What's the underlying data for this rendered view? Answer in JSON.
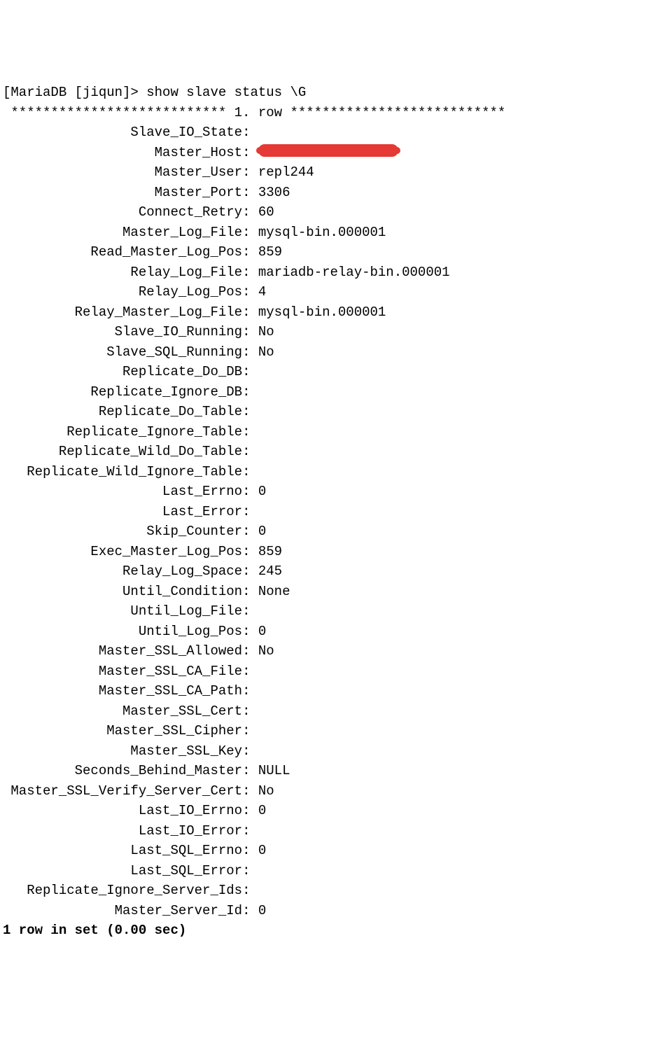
{
  "prompt": "[MariaDB [jiqun]> show slave status \\G",
  "separator_left": " *************************** ",
  "separator_mid": "1. row",
  "separator_right": " ***************************",
  "footer": "1 row in set (0.00 sec)",
  "colon": ": ",
  "fields": [
    {
      "label": "Slave_IO_State",
      "value": "",
      "redacted": false
    },
    {
      "label": "Master_Host",
      "value": "",
      "redacted": true
    },
    {
      "label": "Master_User",
      "value": "repl244",
      "redacted": false
    },
    {
      "label": "Master_Port",
      "value": "3306",
      "redacted": false
    },
    {
      "label": "Connect_Retry",
      "value": "60",
      "redacted": false
    },
    {
      "label": "Master_Log_File",
      "value": "mysql-bin.000001",
      "redacted": false
    },
    {
      "label": "Read_Master_Log_Pos",
      "value": "859",
      "redacted": false
    },
    {
      "label": "Relay_Log_File",
      "value": "mariadb-relay-bin.000001",
      "redacted": false
    },
    {
      "label": "Relay_Log_Pos",
      "value": "4",
      "redacted": false
    },
    {
      "label": "Relay_Master_Log_File",
      "value": "mysql-bin.000001",
      "redacted": false
    },
    {
      "label": "Slave_IO_Running",
      "value": "No",
      "redacted": false
    },
    {
      "label": "Slave_SQL_Running",
      "value": "No",
      "redacted": false
    },
    {
      "label": "Replicate_Do_DB",
      "value": "",
      "redacted": false
    },
    {
      "label": "Replicate_Ignore_DB",
      "value": "",
      "redacted": false
    },
    {
      "label": "Replicate_Do_Table",
      "value": "",
      "redacted": false
    },
    {
      "label": "Replicate_Ignore_Table",
      "value": "",
      "redacted": false
    },
    {
      "label": "Replicate_Wild_Do_Table",
      "value": "",
      "redacted": false
    },
    {
      "label": "Replicate_Wild_Ignore_Table",
      "value": "",
      "redacted": false
    },
    {
      "label": "Last_Errno",
      "value": "0",
      "redacted": false
    },
    {
      "label": "Last_Error",
      "value": "",
      "redacted": false
    },
    {
      "label": "Skip_Counter",
      "value": "0",
      "redacted": false
    },
    {
      "label": "Exec_Master_Log_Pos",
      "value": "859",
      "redacted": false
    },
    {
      "label": "Relay_Log_Space",
      "value": "245",
      "redacted": false
    },
    {
      "label": "Until_Condition",
      "value": "None",
      "redacted": false
    },
    {
      "label": "Until_Log_File",
      "value": "",
      "redacted": false
    },
    {
      "label": "Until_Log_Pos",
      "value": "0",
      "redacted": false
    },
    {
      "label": "Master_SSL_Allowed",
      "value": "No",
      "redacted": false
    },
    {
      "label": "Master_SSL_CA_File",
      "value": "",
      "redacted": false
    },
    {
      "label": "Master_SSL_CA_Path",
      "value": "",
      "redacted": false
    },
    {
      "label": "Master_SSL_Cert",
      "value": "",
      "redacted": false
    },
    {
      "label": "Master_SSL_Cipher",
      "value": "",
      "redacted": false
    },
    {
      "label": "Master_SSL_Key",
      "value": "",
      "redacted": false
    },
    {
      "label": "Seconds_Behind_Master",
      "value": "NULL",
      "redacted": false
    },
    {
      "label": "Master_SSL_Verify_Server_Cert",
      "value": "No",
      "redacted": false
    },
    {
      "label": "Last_IO_Errno",
      "value": "0",
      "redacted": false
    },
    {
      "label": "Last_IO_Error",
      "value": "",
      "redacted": false
    },
    {
      "label": "Last_SQL_Errno",
      "value": "0",
      "redacted": false
    },
    {
      "label": "Last_SQL_Error",
      "value": "",
      "redacted": false
    },
    {
      "label": "Replicate_Ignore_Server_Ids",
      "value": "",
      "redacted": false
    },
    {
      "label": "Master_Server_Id",
      "value": "0",
      "redacted": false
    }
  ]
}
